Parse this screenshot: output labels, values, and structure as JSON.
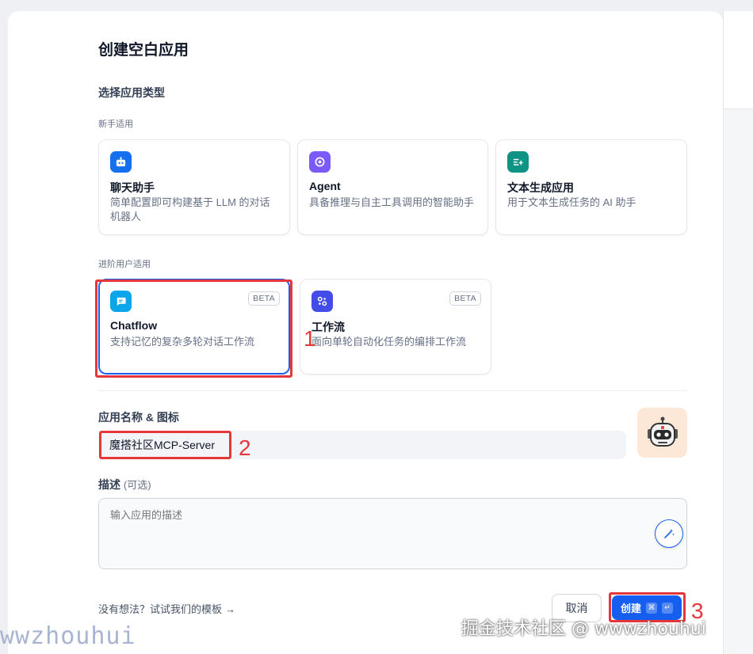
{
  "dialog": {
    "title": "创建空白应用",
    "type_section_title": "选择应用类型",
    "beginner_label": "新手适用",
    "advanced_label": "进阶用户适用"
  },
  "app_types_beginner": [
    {
      "name": "聊天助手",
      "desc": "简单配置即可构建基于 LLM 的对话机器人",
      "icon": "chat-bot-icon",
      "color": "#1570ef"
    },
    {
      "name": "Agent",
      "desc": "具备推理与自主工具调用的智能助手",
      "icon": "agent-icon",
      "color": "#7a5af8"
    },
    {
      "name": "文本生成应用",
      "desc": "用于文本生成任务的 AI 助手",
      "icon": "text-generate-icon",
      "color": "#0e9384"
    }
  ],
  "app_types_advanced": [
    {
      "name": "Chatflow",
      "desc": "支持记忆的复杂多轮对话工作流",
      "badge": "BETA",
      "icon": "chatflow-icon",
      "color": "#0ba5ec"
    },
    {
      "name": "工作流",
      "desc": "面向单轮自动化任务的编排工作流",
      "badge": "BETA",
      "icon": "workflow-icon",
      "color": "#444ce7"
    }
  ],
  "name_section": {
    "label": "应用名称 & 图标",
    "value": "魔搭社区MCP-Server",
    "avatar_icon": "robot-avatar-icon"
  },
  "description_section": {
    "label": "描述",
    "optional": "(可选)",
    "placeholder": "输入应用的描述"
  },
  "footer": {
    "template_link": "没有想法？试试我们的模板",
    "cancel": "取消",
    "create": "创建",
    "shortcut_cmd": "⌘",
    "shortcut_enter": "↵"
  },
  "annotations": {
    "num1": "1",
    "num2": "2",
    "num3": "3"
  },
  "watermarks": {
    "left": "wwzhouhui",
    "right": "掘金技术社区 @ wwwzhouhui"
  }
}
